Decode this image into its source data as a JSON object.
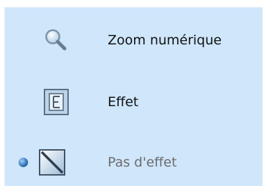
{
  "menu": {
    "items": [
      {
        "label": "Zoom numérique",
        "icon": "magnifier-icon",
        "selected": false,
        "enabled": true
      },
      {
        "label": "Effet",
        "icon": "effect-e-icon",
        "selected": false,
        "enabled": true
      },
      {
        "label": "Pas d'effet",
        "icon": "no-effect-icon",
        "selected": true,
        "enabled": false
      }
    ]
  },
  "colors": {
    "menu_background": "#cfe6fb",
    "text": "#111111",
    "text_disabled": "#6b6b6b",
    "bullet": "#1f6fb8"
  }
}
